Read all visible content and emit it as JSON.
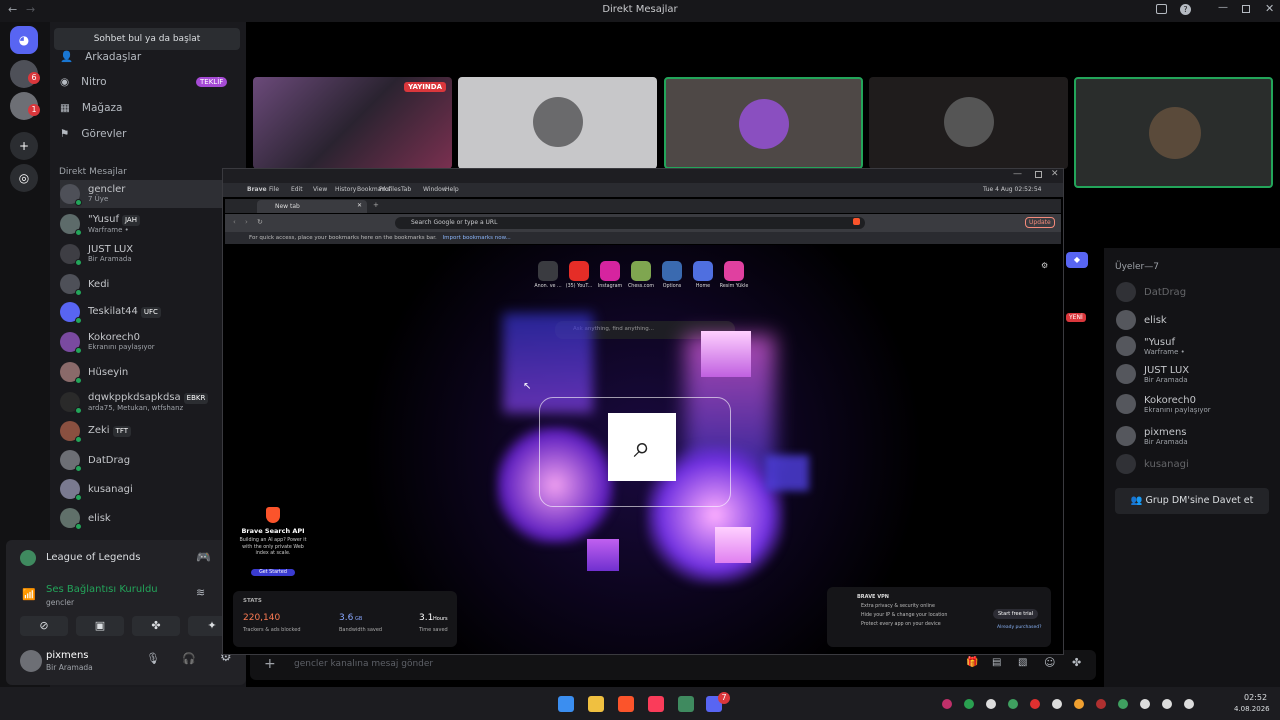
{
  "window": {
    "title": "Direkt Mesajlar"
  },
  "channels": {
    "search": "Sohbet bul ya da başlat",
    "nav": [
      {
        "label": "Arkadaşlar"
      },
      {
        "label": "Nitro",
        "badge": "TEKLİF"
      },
      {
        "label": "Mağaza"
      },
      {
        "label": "Görevler"
      }
    ],
    "dm_header": "Direkt Mesajlar",
    "dms": [
      {
        "name": "gencler",
        "sub": "7 Üye"
      },
      {
        "name": "\"Yusuf",
        "tag": "JAH",
        "sub": "Warframe •"
      },
      {
        "name": "JUST LUX",
        "sub": "Bir Aramada"
      },
      {
        "name": "Kedi",
        "sub": ""
      },
      {
        "name": "Teskilat44",
        "tag": "UFC",
        "sub": ""
      },
      {
        "name": "Kokorech0",
        "sub": "Ekranını paylaşıyor"
      },
      {
        "name": "Hüseyin",
        "sub": ""
      },
      {
        "name": "dqwkppkdsapkdsa",
        "tag": "EBKR",
        "sub": "arda75, Metukan, wtfshanz"
      },
      {
        "name": "Zeki",
        "tag": "TFT",
        "sub": ""
      },
      {
        "name": "DatDrag",
        "sub": ""
      },
      {
        "name": "kusanagi",
        "sub": ""
      },
      {
        "name": "elisk",
        "sub": ""
      }
    ],
    "game": "League of Legends",
    "voice": {
      "status": "Ses Bağlantısı Kuruldu",
      "channel": "gencler"
    },
    "user": {
      "name": "pixmens",
      "status": "Bir Aramada"
    }
  },
  "stream": {
    "live_badge": "YAYINDA"
  },
  "members": {
    "header": "Üyeler—7",
    "list": [
      {
        "name": "DatDrag",
        "sub": ""
      },
      {
        "name": "elisk",
        "sub": ""
      },
      {
        "name": "\"Yusuf",
        "sub": "Warframe •"
      },
      {
        "name": "JUST LUX",
        "sub": "Bir Aramada"
      },
      {
        "name": "Kokorech0",
        "sub": "Ekranını paylaşıyor"
      },
      {
        "name": "pixmens",
        "sub": "Bir Aramada"
      },
      {
        "name": "kusanagi",
        "sub": ""
      }
    ],
    "invite": "Grup DM'sine Davet et",
    "new_badge": "YENİ"
  },
  "message": {
    "placeholder": "gencler kanalına mesaj gönder"
  },
  "brave": {
    "menu": [
      "Brave",
      "File",
      "Edit",
      "View",
      "History",
      "Bookmarks",
      "Profiles",
      "Tab",
      "Window",
      "Help"
    ],
    "clock": "Tue 4 Aug  02:52:54",
    "tab": "New tab",
    "url": "Search Google or type a URL",
    "update": "Update",
    "bookmark_hint": "For quick access, place your bookmarks here on the bookmarks bar.",
    "bookmark_link": "Import bookmarks now...",
    "shortcuts": [
      "Anon. ve ...",
      "(35) YouT...",
      "Instagram",
      "Chess.com",
      "Options",
      "Home",
      "Resim Yükle"
    ],
    "ask": "Ask anything, find anything...",
    "api": {
      "title": "Brave Search API",
      "text": "Building an AI app? Power it with the only private Web index at scale.",
      "button": "Get Started"
    },
    "stats": {
      "label": "STATS",
      "trackers": "220,140",
      "trackers_label": "Trackers & ads blocked",
      "bandwidth": "3.6",
      "bandwidth_unit": "GB",
      "bandwidth_label": "Bandwidth saved",
      "time": "3.1",
      "time_unit": "Hours",
      "time_label": "Time saved"
    },
    "vpn": {
      "title": "BRAVE VPN",
      "lines": [
        "Extra privacy & security online",
        "Hide your IP & change your location",
        "Protect every app on your device"
      ],
      "button": "Start free trial",
      "link": "Already purchased?"
    }
  },
  "taskbar": {
    "time": "02:52",
    "date": "4.08.2026"
  },
  "colors": {
    "accent": "#5865f2",
    "online": "#23a55a",
    "danger": "#da373c",
    "brave": "#fb542b"
  }
}
